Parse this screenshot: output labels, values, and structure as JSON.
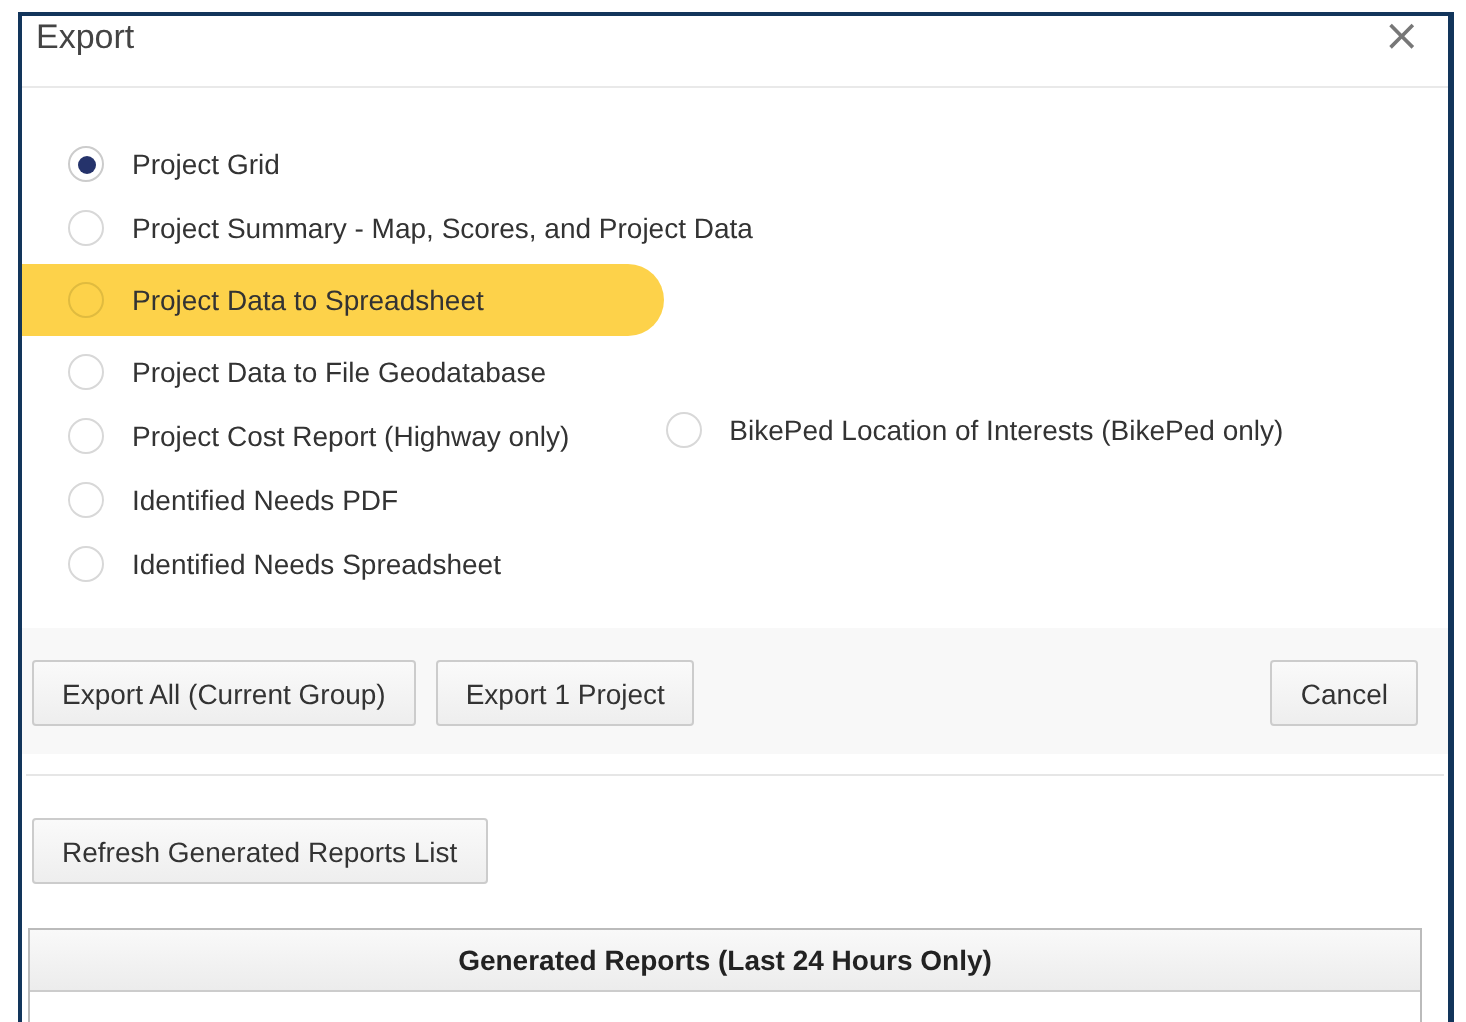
{
  "window": {
    "title": "Export",
    "close": "×"
  },
  "option_rows": [
    {
      "options": [
        {
          "label": "Project Grid",
          "selected": true,
          "highlighted": false
        }
      ]
    },
    {
      "options": [
        {
          "label": "Project Summary - Map, Scores, and Project Data",
          "selected": false,
          "highlighted": false
        }
      ]
    },
    {
      "options": [
        {
          "label": "Project Data to Spreadsheet",
          "selected": false,
          "highlighted": true
        }
      ]
    },
    {
      "options": [
        {
          "label": "Project Data to File Geodatabase",
          "selected": false,
          "highlighted": false
        }
      ]
    },
    {
      "options": [
        {
          "label": "Project Cost Report (Highway only)",
          "selected": false,
          "highlighted": false
        },
        {
          "label": "BikePed Location of Interests (BikePed only)",
          "selected": false,
          "highlighted": false
        }
      ]
    },
    {
      "options": [
        {
          "label": "Identified Needs PDF",
          "selected": false,
          "highlighted": false
        }
      ]
    },
    {
      "options": [
        {
          "label": "Identified Needs Spreadsheet",
          "selected": false,
          "highlighted": false
        }
      ]
    }
  ],
  "footer_buttons": [
    {
      "label": "Export All (Current Group)",
      "kind": "export"
    },
    {
      "label": "Export 1 Project",
      "kind": "export"
    },
    {
      "label": "Cancel",
      "kind": "cancel"
    }
  ],
  "refresh_button": "Refresh Generated Reports List",
  "reports_table": {
    "header": "Generated Reports (Last 24 Hours Only)"
  }
}
